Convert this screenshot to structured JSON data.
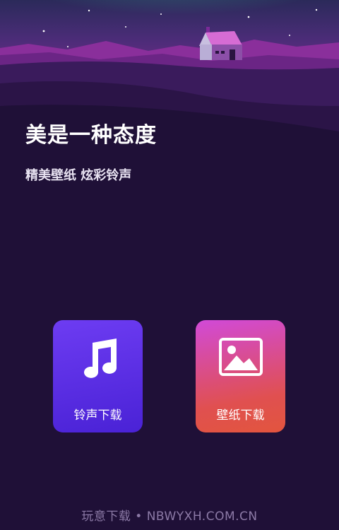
{
  "hero": {
    "headline": "美是一种态度",
    "subline": "精美壁纸 炫彩铃声"
  },
  "actions": [
    {
      "label": "铃声下载",
      "icon": "music-note-icon",
      "colors": [
        "#6d3cf2",
        "#4a22d6"
      ]
    },
    {
      "label": "壁纸下载",
      "icon": "image-icon",
      "colors": [
        "#d14ad8",
        "#e2553e"
      ]
    }
  ],
  "footer": {
    "watermark": "玩意下载 • NBWYXH.COM.CN"
  }
}
